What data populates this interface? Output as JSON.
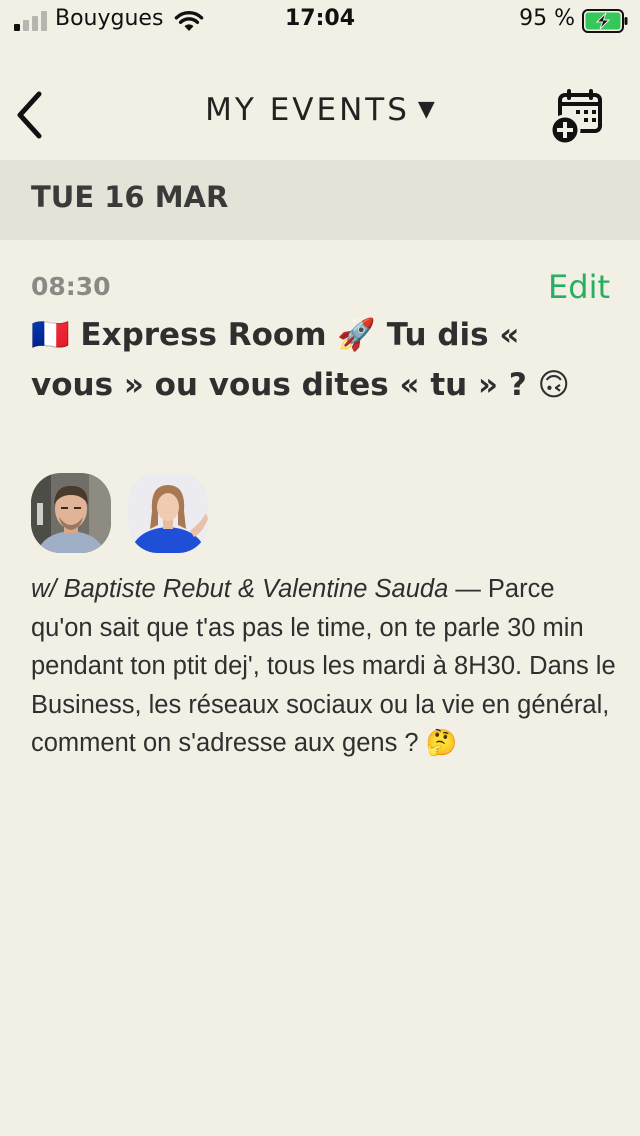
{
  "status_bar": {
    "carrier": "Bouygues",
    "time": "17:04",
    "battery_percent": "95 %",
    "battery_level": 0.95,
    "signal_bars_active": 1,
    "signal_bars_total": 4
  },
  "nav": {
    "title": "MY EVENTS",
    "title_caret": "▼",
    "back_icon": "chevron-left-icon",
    "calendar_add_icon": "calendar-add-icon"
  },
  "date_header": "TUE 16 MAR",
  "event": {
    "time": "08:30",
    "edit_label": "Edit",
    "title": "🇫🇷 Express Room 🚀 Tu dis « vous » ou vous dites « tu » ? 🙃",
    "hosts_prefix": "w/ ",
    "hosts": "Baptiste Rebut & Valentine Sauda",
    "description": " — Parce qu'on sait que t'as pas le time, on te parle 30 min pendant ton ptit dej', tous les mardi à 8H30. Dans le Business, les réseaux sociaux ou la vie en général, comment on s'adresse aux gens ? 🤔"
  },
  "colors": {
    "background": "#f2efe4",
    "date_header_bg": "#e5e3d8",
    "edit_green": "#27ae60",
    "battery_green": "#35c759"
  }
}
